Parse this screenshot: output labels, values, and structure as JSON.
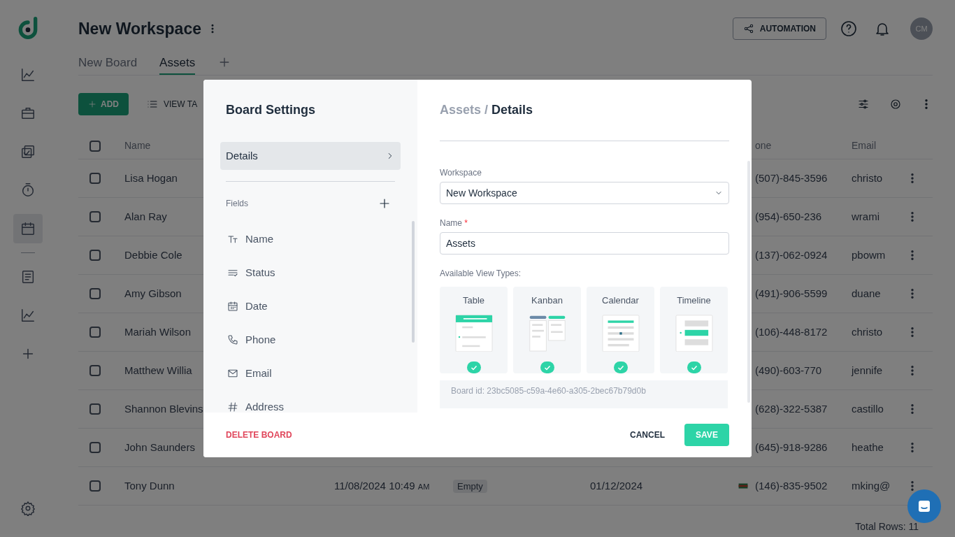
{
  "sidebar": {
    "items": [
      {
        "kind": "chart",
        "selected": false
      },
      {
        "kind": "briefcase",
        "selected": false
      },
      {
        "kind": "tasks",
        "selected": false
      },
      {
        "kind": "timer",
        "selected": false
      },
      {
        "kind": "calendar",
        "selected": true
      },
      {
        "kind": "document",
        "selected": false
      },
      {
        "kind": "chart",
        "selected": false
      },
      {
        "kind": "plus",
        "selected": false
      }
    ]
  },
  "header": {
    "title": "New Workspace",
    "automation": "AUTOMATION",
    "avatar": "CM"
  },
  "tabs": [
    {
      "label": "New Board",
      "selected": false
    },
    {
      "label": "Assets",
      "selected": true
    }
  ],
  "toolbar": {
    "add": "ADD",
    "view": "VIEW TA"
  },
  "table": {
    "all_checked": false,
    "columns": {
      "name": "Name",
      "phone": "one",
      "email": "Email"
    },
    "rows": [
      {
        "checked": false,
        "name": "Lisa Hogan",
        "phone": "(507)-845-3596",
        "email": "christo"
      },
      {
        "checked": false,
        "name": "Alan Ray",
        "phone": "(954)-650-236",
        "email": "wrami"
      },
      {
        "checked": false,
        "name": "Debbie Cole",
        "phone": "(137)-062-0924",
        "email": "pbowm"
      },
      {
        "checked": false,
        "name": "Amy Gibson",
        "phone": "(491)-906-5599",
        "email": "duane"
      },
      {
        "checked": false,
        "name": "Mariah Wilson",
        "phone": "(106)-448-8172",
        "email": "christo"
      },
      {
        "checked": false,
        "name": "Matthew Willia",
        "phone": "(490)-603-770",
        "email": "jennife"
      },
      {
        "checked": false,
        "name": "Shannon Blevins",
        "phone": "(628)-322-5387",
        "email": "castillo"
      },
      {
        "checked": false,
        "name": "John Saunders",
        "phone": "(645)-918-9286",
        "email": "heathe"
      },
      {
        "checked": false,
        "name": "Tony Dunn",
        "created": "11/08/2024 10:49",
        "created_suffix": "AM",
        "status": "Empty",
        "date": "01/12/2024",
        "phone": "(146)-835-9502",
        "email": "mking@"
      }
    ],
    "total": "Total Rows: 11"
  },
  "modal": {
    "title": "Board Settings",
    "nav": [
      {
        "label": "Details",
        "selected": true
      }
    ],
    "fields_label": "Fields",
    "fields": [
      {
        "kind": "text",
        "label": "Name"
      },
      {
        "kind": "status",
        "label": "Status"
      },
      {
        "kind": "date",
        "label": "Date"
      },
      {
        "kind": "phone",
        "label": "Phone"
      },
      {
        "kind": "email",
        "label": "Email"
      },
      {
        "kind": "number",
        "label": "Address"
      }
    ],
    "breadcrumb": {
      "parent": "Assets",
      "separator": "/",
      "current": "Details"
    },
    "workspace": {
      "label": "Workspace",
      "value": "New Workspace"
    },
    "name": {
      "label": "Name",
      "required": "*",
      "value": "Assets"
    },
    "view_types_label": "Available View Types:",
    "view_types": [
      {
        "kind": "table",
        "label": "Table",
        "checked": true
      },
      {
        "kind": "kanban",
        "label": "Kanban",
        "checked": true
      },
      {
        "kind": "calendar",
        "label": "Calendar",
        "checked": true
      },
      {
        "kind": "timeline",
        "label": "Timeline",
        "checked": true
      }
    ],
    "board_id": "Board id: 23bc5085-c59a-4e60-a305-2bec67b79d0b",
    "delete": "DELETE BOARD",
    "cancel": "CANCEL",
    "save": "SAVE"
  }
}
